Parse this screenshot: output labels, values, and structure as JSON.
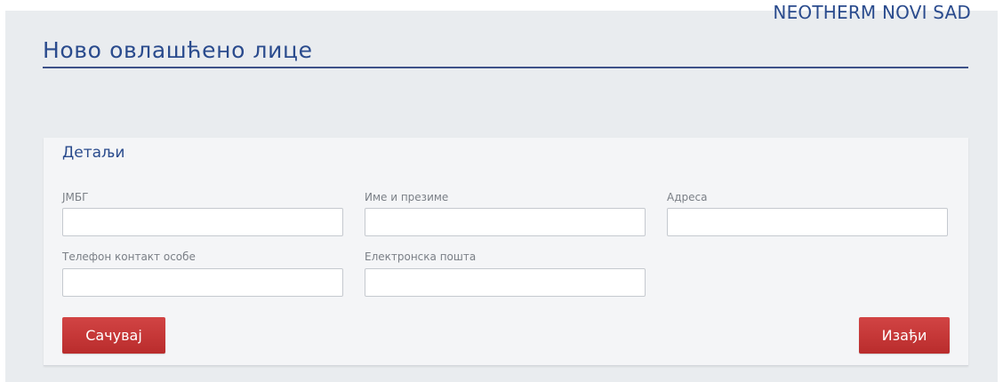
{
  "header": {
    "company": "NEOTHERM NOVI SAD",
    "page_title": "Ново овлашћено лице"
  },
  "details": {
    "section_title": "Детаљи",
    "fields": {
      "jmbg": {
        "label": "ЈМБГ",
        "value": "",
        "placeholder": ""
      },
      "name": {
        "label": "Име и презиме",
        "value": "",
        "placeholder": ""
      },
      "address": {
        "label": "Адреса",
        "value": "",
        "placeholder": ""
      },
      "phone": {
        "label": "Телефон контакт особе",
        "value": "",
        "placeholder": ""
      },
      "email": {
        "label": "Електронска пошта",
        "value": "",
        "placeholder": ""
      }
    }
  },
  "actions": {
    "save_label": "Сачувај",
    "exit_label": "Изађи"
  },
  "colors": {
    "accent_blue": "#2a4b8d",
    "button_red": "#c33535",
    "page_bg": "#e9ecef",
    "card_bg": "#f4f5f7"
  }
}
